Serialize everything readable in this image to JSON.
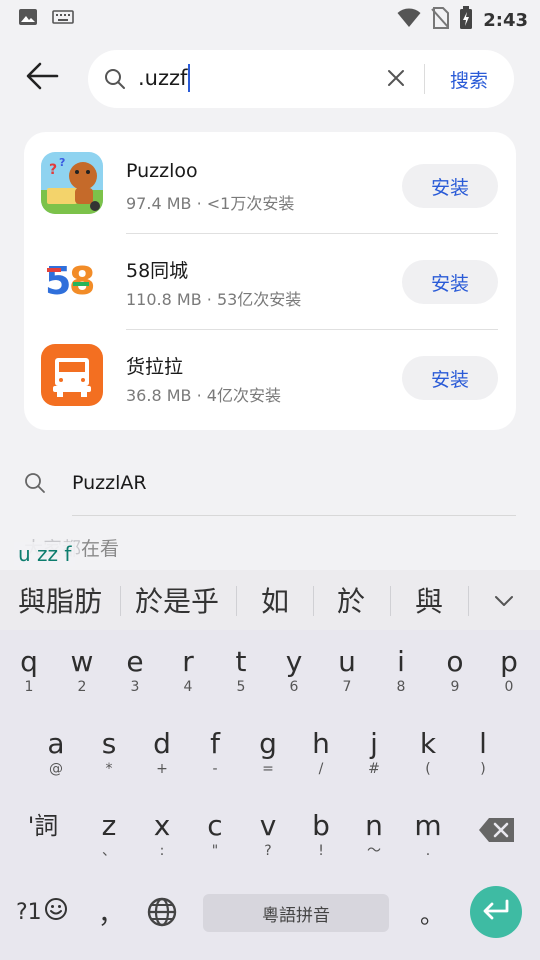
{
  "status_bar": {
    "time": "2:43",
    "icons": [
      "image-icon",
      "keyboard-icon",
      "wifi-icon",
      "no-sim-icon",
      "battery-charging-icon"
    ]
  },
  "search": {
    "query": ".uzzf",
    "search_button": "搜索"
  },
  "apps": [
    {
      "name": "Puzzloo",
      "size": "97.4 MB",
      "installs": "<1万次安装",
      "install_label": "安装"
    },
    {
      "name": "58同城",
      "size": "110.8 MB",
      "installs": "53亿次安装",
      "install_label": "安装"
    },
    {
      "name": "货拉拉",
      "size": "36.8 MB",
      "installs": "4亿次安装",
      "install_label": "安装"
    }
  ],
  "suggestion": {
    "text": "PuzzlAR"
  },
  "watching_partial": "在看",
  "keyboard": {
    "composing": "u zz f",
    "candidates": [
      "與脂肪",
      "於是乎",
      "如",
      "於",
      "與"
    ],
    "rows": [
      [
        {
          "k": "q",
          "s": "1"
        },
        {
          "k": "w",
          "s": "2"
        },
        {
          "k": "e",
          "s": "3"
        },
        {
          "k": "r",
          "s": "4"
        },
        {
          "k": "t",
          "s": "5"
        },
        {
          "k": "y",
          "s": "6"
        },
        {
          "k": "u",
          "s": "7"
        },
        {
          "k": "i",
          "s": "8"
        },
        {
          "k": "o",
          "s": "9"
        },
        {
          "k": "p",
          "s": "0"
        }
      ],
      [
        {
          "k": "a",
          "s": "@"
        },
        {
          "k": "s",
          "s": "*"
        },
        {
          "k": "d",
          "s": "+"
        },
        {
          "k": "f",
          "s": "-"
        },
        {
          "k": "g",
          "s": "="
        },
        {
          "k": "h",
          "s": "/"
        },
        {
          "k": "j",
          "s": "#"
        },
        {
          "k": "k",
          "s": "("
        },
        {
          "k": "l",
          "s": ")"
        }
      ],
      [
        {
          "k": "z",
          "s": "、"
        },
        {
          "k": "x",
          "s": ":"
        },
        {
          "k": "c",
          "s": "\""
        },
        {
          "k": "v",
          "s": "?"
        },
        {
          "k": "b",
          "s": "!"
        },
        {
          "k": "n",
          "s": "～"
        },
        {
          "k": "m",
          "s": "."
        }
      ]
    ],
    "shift_label": "'詞",
    "symbols_label": "?1",
    "comma": "，",
    "space_label": "粵語拼音",
    "period": "。"
  },
  "colors": {
    "accent": "#2a5bd7",
    "enter": "#3ebba3",
    "huolala": "#f36f21"
  }
}
